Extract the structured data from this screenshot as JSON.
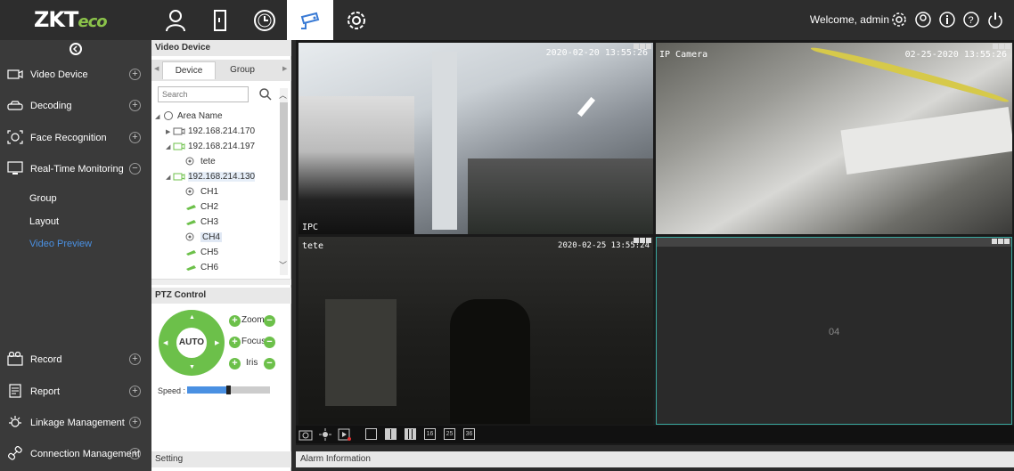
{
  "topbar": {
    "logo_main": "ZKT",
    "logo_eco": "eco",
    "welcome": "Welcome, admin",
    "nav_icons": [
      "person-icon",
      "door-icon",
      "clock-icon",
      "camera-icon",
      "gear-icon"
    ],
    "right_icons": [
      "settings-icon",
      "user-icon",
      "info-icon",
      "help-icon",
      "power-icon"
    ]
  },
  "sidebar": {
    "items": [
      {
        "label": "Video Device",
        "icon": "video-device-icon"
      },
      {
        "label": "Decoding",
        "icon": "decoding-icon"
      },
      {
        "label": "Face Recognition",
        "icon": "face-icon"
      },
      {
        "label": "Real-Time Monitoring",
        "icon": "monitor-icon"
      },
      {
        "label": "Record",
        "icon": "record-icon"
      },
      {
        "label": "Report",
        "icon": "report-icon"
      },
      {
        "label": "Linkage Management",
        "icon": "linkage-icon"
      },
      {
        "label": "Connection Management",
        "icon": "connection-icon"
      }
    ],
    "subitems": [
      "Group",
      "Layout",
      "Video Preview"
    ]
  },
  "midpanel": {
    "header": "Video Device",
    "tabs": [
      "Device",
      "Group"
    ],
    "search_placeholder": "Search",
    "tree": {
      "root": "Area Name",
      "nodes": [
        "192.168.214.170",
        "192.168.214.197",
        "tete",
        "192.168.214.130",
        "CH1",
        "CH2",
        "CH3",
        "CH4",
        "CH5",
        "CH6"
      ]
    },
    "ptz_header": "PTZ Control",
    "ptz_center": "AUTO",
    "ptz_labels": [
      "Zoom",
      "Focus",
      "Iris"
    ],
    "speed_label": "Speed :",
    "speed_level": 0.47,
    "setting_label": "Setting"
  },
  "video": {
    "panes": [
      {
        "title": "",
        "timestamp": "2020-02-20 13:55:26",
        "corner_label": "IPC"
      },
      {
        "title": "IP Camera",
        "timestamp": "02-25-2020 13:55:26",
        "corner_label": ""
      },
      {
        "title": "tete",
        "timestamp": "2020-02-25 13:55:24",
        "corner_label": ""
      },
      {
        "title": "",
        "timestamp": "",
        "corner_label": "04"
      }
    ],
    "toolbar_labels": [
      "16",
      "25",
      "36"
    ],
    "alarm_label": "Alarm Information"
  },
  "colors": {
    "accent": "#6cc04a",
    "link": "#4a90e2",
    "bg_dark": "#2d2d2d"
  }
}
